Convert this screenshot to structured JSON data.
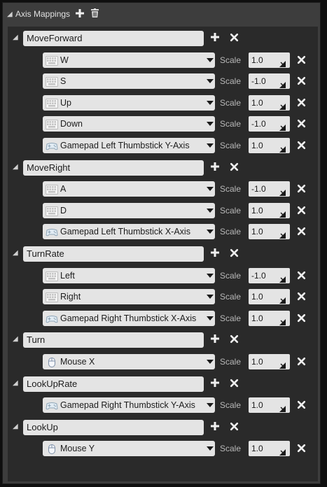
{
  "header": {
    "title": "Axis Mappings"
  },
  "scale_label": "Scale",
  "mappings": [
    {
      "name": "MoveForward",
      "keys": [
        {
          "key": "W",
          "icon": "keyboard-icon",
          "scale": "1.0"
        },
        {
          "key": "S",
          "icon": "keyboard-icon",
          "scale": "-1.0"
        },
        {
          "key": "Up",
          "icon": "keyboard-icon",
          "scale": "1.0"
        },
        {
          "key": "Down",
          "icon": "keyboard-icon",
          "scale": "-1.0"
        },
        {
          "key": "Gamepad Left Thumbstick Y-Axis",
          "icon": "gamepad-icon",
          "scale": "1.0"
        }
      ]
    },
    {
      "name": "MoveRight",
      "keys": [
        {
          "key": "A",
          "icon": "keyboard-icon",
          "scale": "-1.0"
        },
        {
          "key": "D",
          "icon": "keyboard-icon",
          "scale": "1.0"
        },
        {
          "key": "Gamepad Left Thumbstick X-Axis",
          "icon": "gamepad-icon",
          "scale": "1.0"
        }
      ]
    },
    {
      "name": "TurnRate",
      "keys": [
        {
          "key": "Left",
          "icon": "keyboard-icon",
          "scale": "-1.0"
        },
        {
          "key": "Right",
          "icon": "keyboard-icon",
          "scale": "1.0"
        },
        {
          "key": "Gamepad Right Thumbstick X-Axis",
          "icon": "gamepad-icon",
          "scale": "1.0"
        }
      ]
    },
    {
      "name": "Turn",
      "keys": [
        {
          "key": "Mouse X",
          "icon": "mouse-icon",
          "scale": "1.0"
        }
      ]
    },
    {
      "name": "LookUpRate",
      "keys": [
        {
          "key": "Gamepad Right Thumbstick Y-Axis",
          "icon": "gamepad-icon",
          "scale": "1.0"
        }
      ]
    },
    {
      "name": "LookUp",
      "keys": [
        {
          "key": "Mouse Y",
          "icon": "mouse-icon",
          "scale": "1.0"
        }
      ]
    }
  ]
}
